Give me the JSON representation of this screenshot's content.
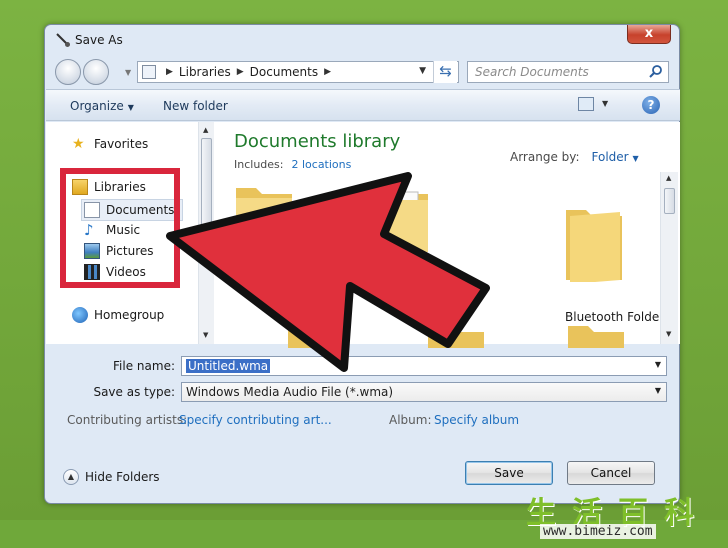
{
  "window": {
    "title": "Save As",
    "close_label": "x"
  },
  "navbar": {
    "address_parts": [
      "Libraries",
      "Documents"
    ],
    "search_placeholder": "Search Documents"
  },
  "toolbar": {
    "organize_label": "Organize",
    "new_folder_label": "New folder"
  },
  "sidebar": {
    "favorites": "Favorites",
    "libraries": "Libraries",
    "items": [
      {
        "label": "Documents",
        "icon": "documents-icon",
        "selected": true
      },
      {
        "label": "Music",
        "icon": "music-icon",
        "selected": false
      },
      {
        "label": "Pictures",
        "icon": "pictures-icon",
        "selected": false
      },
      {
        "label": "Videos",
        "icon": "videos-icon",
        "selected": false
      }
    ],
    "homegroup": "Homegroup"
  },
  "main": {
    "library_title": "Documents library",
    "includes_label": "Includes:",
    "includes_link": "2 locations",
    "arrange_label": "Arrange by:",
    "arrange_value": "Folder",
    "folders": [
      {
        "label": ""
      },
      {
        "label": ""
      },
      {
        "label": "Bluetooth Folder"
      },
      {
        "label": ""
      },
      {
        "label": ""
      },
      {
        "label": ""
      }
    ]
  },
  "form": {
    "file_name_label": "File name:",
    "file_name_value": "Untitled.wma",
    "save_type_label": "Save as type:",
    "save_type_value": "Windows Media Audio File (*.wma)",
    "artists_label": "Contributing artists:",
    "artists_link": "Specify contributing art...",
    "album_label": "Album:",
    "album_link": "Specify album"
  },
  "footer": {
    "hide_folders_label": "Hide Folders",
    "save_label": "Save",
    "cancel_label": "Cancel"
  },
  "watermark": {
    "chars": "生活百科",
    "url": "www.bimeiz.com"
  },
  "colors": {
    "background": "#6fa83a",
    "annotation_red": "#d9263c",
    "library_title": "#1f7a2c",
    "link": "#1f6fbf"
  }
}
